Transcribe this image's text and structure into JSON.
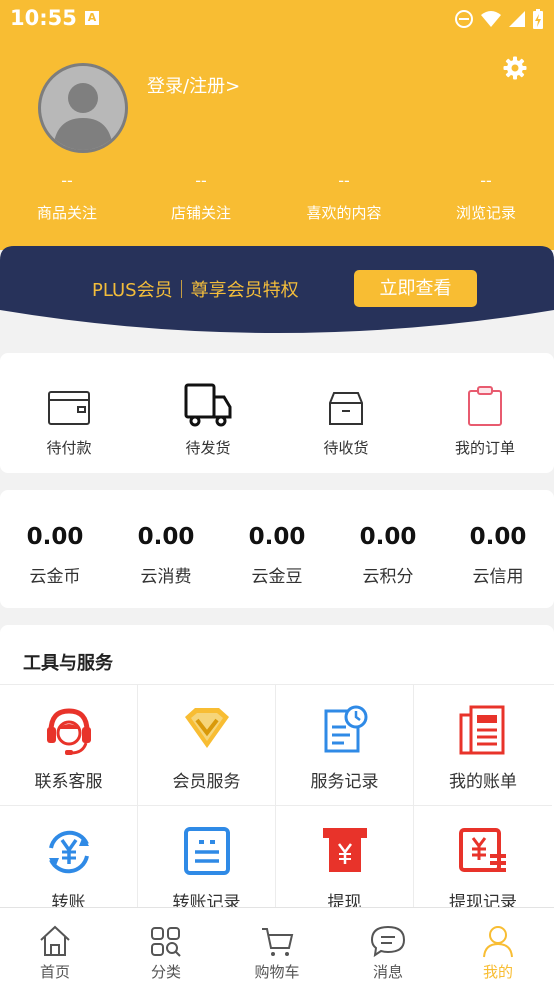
{
  "status_bar": {
    "time": "10:55",
    "notification_icon": "A"
  },
  "header": {
    "login_text": "登录/注册>",
    "stats": [
      {
        "value": "--",
        "label": "商品关注"
      },
      {
        "value": "--",
        "label": "店铺关注"
      },
      {
        "value": "--",
        "label": "喜欢的内容"
      },
      {
        "value": "--",
        "label": "浏览记录"
      }
    ]
  },
  "plus_banner": {
    "text": "PLUS会员｜尊享会员特权",
    "button": "立即查看"
  },
  "orders": [
    {
      "label": "待付款",
      "icon": "wallet-icon"
    },
    {
      "label": "待发货",
      "icon": "truck-icon"
    },
    {
      "label": "待收货",
      "icon": "box-icon"
    },
    {
      "label": "我的订单",
      "icon": "clipboard-icon"
    }
  ],
  "assets": [
    {
      "value": "0.00",
      "label": "云金币"
    },
    {
      "value": "0.00",
      "label": "云消费"
    },
    {
      "value": "0.00",
      "label": "云金豆"
    },
    {
      "value": "0.00",
      "label": "云积分"
    },
    {
      "value": "0.00",
      "label": "云信用"
    }
  ],
  "tools": {
    "title": "工具与服务",
    "items": [
      {
        "label": "联系客服",
        "icon": "headset-icon"
      },
      {
        "label": "会员服务",
        "icon": "vip-diamond-icon"
      },
      {
        "label": "服务记录",
        "icon": "document-clock-icon"
      },
      {
        "label": "我的账单",
        "icon": "bill-icon"
      },
      {
        "label": "转账",
        "icon": "transfer-yen-icon"
      },
      {
        "label": "转账记录",
        "icon": "transfer-record-icon"
      },
      {
        "label": "提现",
        "icon": "withdraw-icon"
      },
      {
        "label": "提现记录",
        "icon": "withdraw-record-icon"
      }
    ]
  },
  "tabbar": {
    "items": [
      {
        "label": "首页",
        "icon": "home-icon"
      },
      {
        "label": "分类",
        "icon": "category-icon"
      },
      {
        "label": "购物车",
        "icon": "cart-icon"
      },
      {
        "label": "消息",
        "icon": "message-icon"
      },
      {
        "label": "我的",
        "icon": "user-icon",
        "active": true
      }
    ]
  },
  "colors": {
    "accent": "#f8bd33",
    "banner": "#27325a",
    "red": "#e8332a",
    "blue": "#2f8ae6"
  }
}
